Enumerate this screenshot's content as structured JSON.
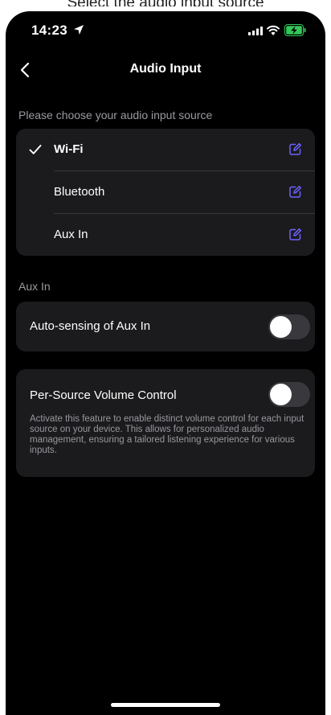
{
  "caption": "Select the audio input source",
  "status_bar": {
    "time": "14:23",
    "location_icon": "location-arrow-icon",
    "signal_icon": "cellular-signal-icon",
    "wifi_icon": "wifi-icon",
    "battery_icon": "battery-charging-icon",
    "battery_color": "#34c759"
  },
  "nav": {
    "title": "Audio Input",
    "back_icon": "chevron-left-icon"
  },
  "source_section": {
    "label": "Please choose your audio input source",
    "options": [
      {
        "label": "Wi-Fi",
        "selected": true
      },
      {
        "label": "Bluetooth",
        "selected": false
      },
      {
        "label": "Aux In",
        "selected": false
      }
    ],
    "edit_icon": "edit-icon",
    "accent_color": "#6e63ff"
  },
  "aux_section": {
    "label": "Aux In",
    "auto_sensing": {
      "label": "Auto-sensing of Aux In",
      "enabled": false
    }
  },
  "per_source": {
    "label": "Per-Source Volume Control",
    "enabled": false,
    "description": "Activate this feature to enable distinct volume control for each input source on your device. This allows for personalized audio management, ensuring a tailored listening experience for various inputs."
  }
}
